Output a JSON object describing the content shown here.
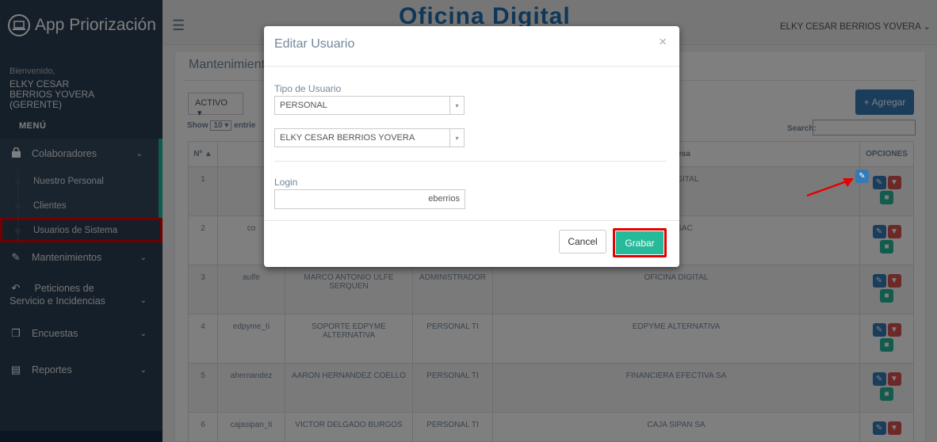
{
  "app": {
    "title": "App Priorización"
  },
  "profile": {
    "welcome": "Bienvenido,",
    "name": "ELKY CESAR BERRIOS YOVERA (GERENTE)"
  },
  "menu": {
    "title": "MENÚ",
    "items": [
      {
        "label": "Colaboradores",
        "icon": "lock-icon"
      },
      {
        "label": "Mantenimientos",
        "icon": "edit-icon"
      },
      {
        "label": "Peticiones de Servicio e Incidencias",
        "icon": "reply-icon"
      },
      {
        "label": "Encuestas",
        "icon": "copy-icon"
      },
      {
        "label": "Reportes",
        "icon": "file-icon"
      }
    ],
    "sub": [
      "Nuestro Personal",
      "Clientes",
      "Usuarios de Sistema"
    ]
  },
  "topbar": {
    "center_logo": "Oficina Digital",
    "user": "ELKY CESAR BERRIOS YOVERA"
  },
  "panel": {
    "title": "Mantenimient",
    "status_filter": "ACTIVO",
    "add_label": "Agregar",
    "show_prefix": "Show",
    "show_value": "10",
    "show_suffix": "entrie",
    "search_label": "Search:"
  },
  "table": {
    "headers": [
      "Nº",
      "",
      "",
      "",
      "mpresa",
      "OPCIONES"
    ],
    "rows": [
      {
        "n": "1",
        "login": "",
        "name": "",
        "type": "",
        "company": "INA DIGITAL"
      },
      {
        "n": "2",
        "login": "co",
        "name": "",
        "type": "",
        "company": "LSA SAC"
      },
      {
        "n": "3",
        "login": "aulfe",
        "name": "MARCO ANTONIO ULFE SERQUEN",
        "type": "ADMINISTRADOR",
        "company": "OFICINA DIGITAL"
      },
      {
        "n": "4",
        "login": "edpyme_ti",
        "name": "SOPORTE EDPYME ALTERNATIVA",
        "type": "PERSONAL TI",
        "company": "EDPYME ALTERNATIVA"
      },
      {
        "n": "5",
        "login": "ahernandez",
        "name": "AARON HERNANDEZ COELLO",
        "type": "PERSONAL TI",
        "company": "FINANCIERA EFECTIVA SA"
      },
      {
        "n": "6",
        "login": "cajasipan_ti",
        "name": "VICTOR DELGADO BURGOS",
        "type": "PERSONAL TI",
        "company": "CAJA SIPAN SA"
      }
    ]
  },
  "modal": {
    "title": "Editar Usuario",
    "close": "×",
    "tipo_label": "Tipo de Usuario",
    "tipo_value": "PERSONAL",
    "persona_value": "ELKY CESAR BERRIOS YOVERA",
    "login_label": "Login",
    "login_value": "eberrios",
    "cancel_label": "Cancel",
    "save_label": "Grabar"
  },
  "colors": {
    "sidebar": "#2a3f54",
    "accent": "#1ABB9C",
    "primary": "#337ab7",
    "success": "#26B99A",
    "danger": "#d9534f",
    "highlight": "#e60000"
  }
}
